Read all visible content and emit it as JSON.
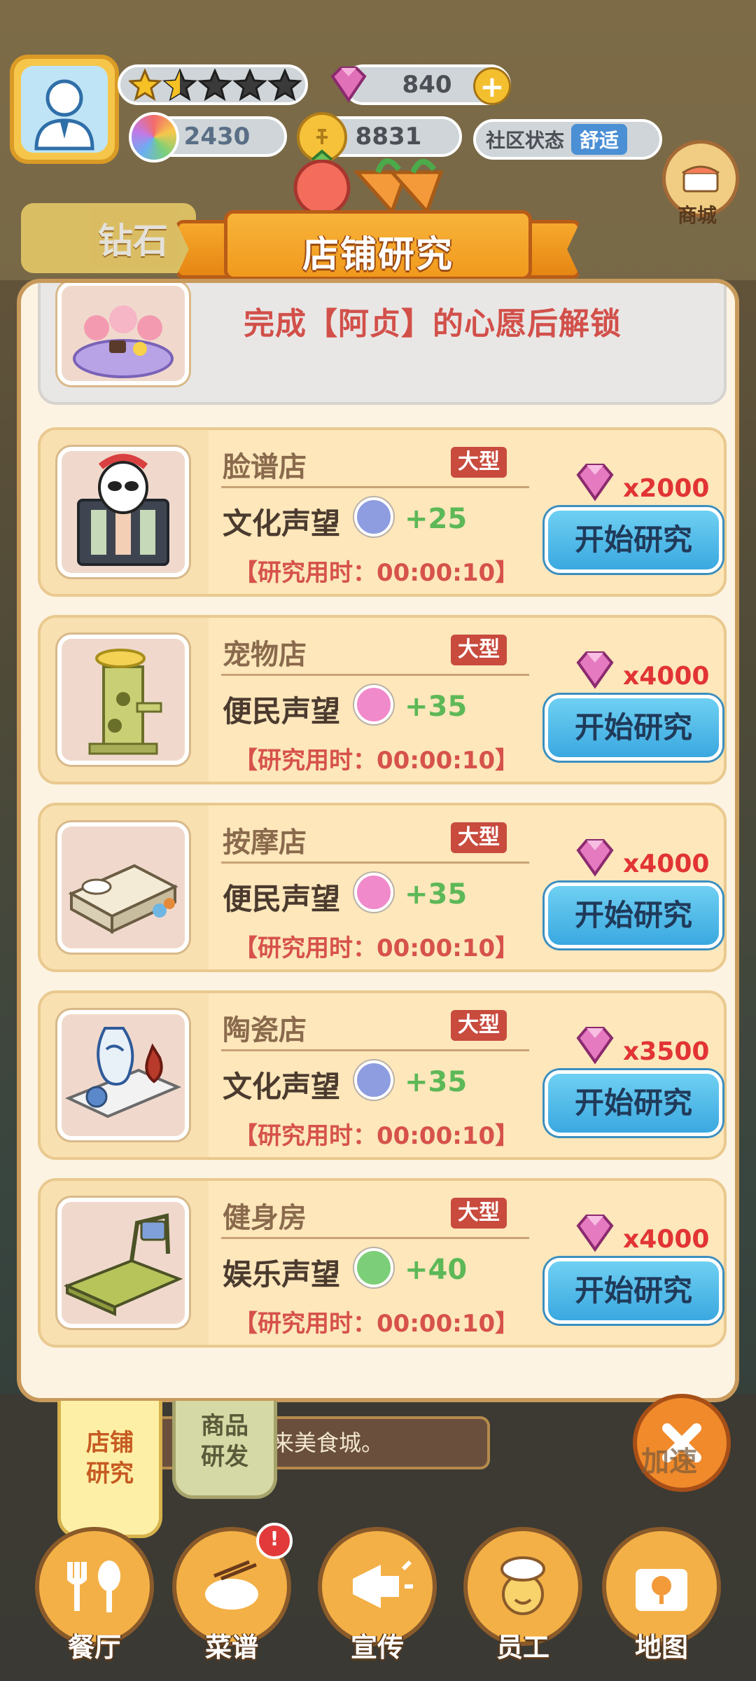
{
  "hud": {
    "stars_filled": 1.5,
    "stars_total": 5,
    "gems": "840",
    "rainbow_coins": "2430",
    "gold_coins": "8831",
    "community_label": "社区状态",
    "community_status": "舒适",
    "mall_label": "商城",
    "sign_text": "钻石"
  },
  "title": "店铺研究",
  "locked": {
    "text": "完成【阿贞】的心愿后解锁"
  },
  "shops": [
    {
      "name": "脸谱店",
      "size": "大型",
      "fame": "文化声望",
      "fame_color": "#8e9ce0",
      "bonus": "+25",
      "time": "【研究用时：00:00:10】",
      "cost": "x2000",
      "button": "开始研究"
    },
    {
      "name": "宠物店",
      "size": "大型",
      "fame": "便民声望",
      "fame_color": "#f08acb",
      "bonus": "+35",
      "time": "【研究用时：00:00:10】",
      "cost": "x4000",
      "button": "开始研究"
    },
    {
      "name": "按摩店",
      "size": "大型",
      "fame": "便民声望",
      "fame_color": "#f08acb",
      "bonus": "+35",
      "time": "【研究用时：00:00:10】",
      "cost": "x4000",
      "button": "开始研究"
    },
    {
      "name": "陶瓷店",
      "size": "大型",
      "fame": "文化声望",
      "fame_color": "#8e9ce0",
      "bonus": "+35",
      "time": "【研究用时：00:00:10】",
      "cost": "x3500",
      "button": "开始研究"
    },
    {
      "name": "健身房",
      "size": "大型",
      "fame": "娱乐声望",
      "fame_color": "#7ccf78",
      "bonus": "+40",
      "time": "【研究用时：00:00:10】",
      "cost": "x4000",
      "button": "开始研究"
    }
  ],
  "tabs": {
    "shop_research": "店铺研究",
    "product_dev": "商品研发"
  },
  "ticker_text": "一起来美食城。",
  "close_hint": "加速",
  "nav": [
    {
      "label": "餐厅",
      "icon": "restaurant-icon"
    },
    {
      "label": "菜谱",
      "icon": "recipe-icon"
    },
    {
      "label": "宣传",
      "icon": "megaphone-icon"
    },
    {
      "label": "员工",
      "icon": "chef-icon"
    },
    {
      "label": "地图",
      "icon": "map-icon"
    }
  ],
  "colors": {
    "banner": "#f8b33a",
    "panel": "#fdf3e2",
    "card": "#fde7bb",
    "button": "#4fbbe8",
    "cost_red": "#e23434",
    "time_red": "#d6524a",
    "bonus_green": "#5db857"
  }
}
